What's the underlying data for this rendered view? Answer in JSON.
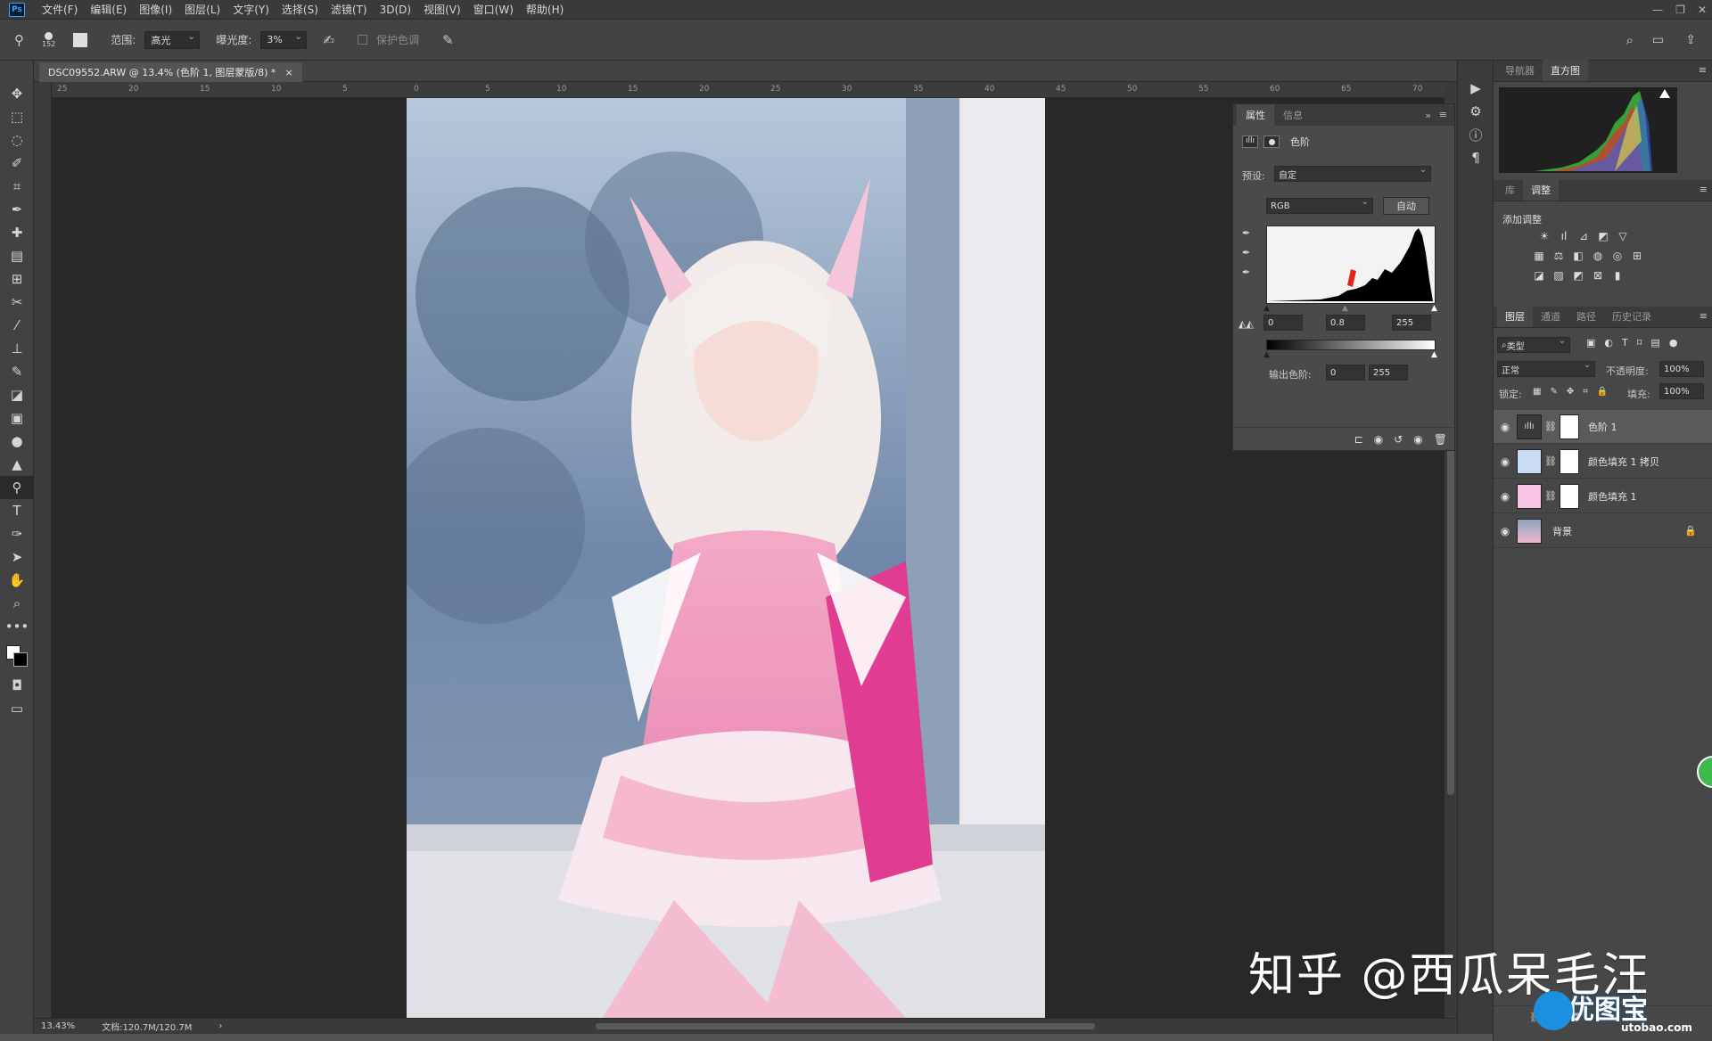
{
  "menubar": {
    "logo": "Ps",
    "items": [
      "文件(F)",
      "编辑(E)",
      "图像(I)",
      "图层(L)",
      "文字(Y)",
      "选择(S)",
      "滤镜(T)",
      "3D(D)",
      "视图(V)",
      "窗口(W)",
      "帮助(H)"
    ]
  },
  "options": {
    "brush_size": "152",
    "range_label": "范围:",
    "range_value": "高光",
    "exposure_label": "曝光度:",
    "exposure_value": "3%",
    "protect_tones": "保护色调"
  },
  "document": {
    "tab_title": "DSC09552.ARW @ 13.4% (色阶 1, 图层蒙版/8) *",
    "close": "×"
  },
  "ruler_h": [
    "25",
    "20",
    "15",
    "10",
    "5",
    "0",
    "5",
    "10",
    "15",
    "20",
    "25",
    "30",
    "35",
    "40",
    "45",
    "50",
    "55",
    "60",
    "65",
    "70"
  ],
  "status": {
    "zoom": "13.43%",
    "doc": "文档:120.7M/120.7M"
  },
  "properties": {
    "tabs": [
      "属性",
      "信息"
    ],
    "title": "色阶",
    "preset_label": "预设:",
    "preset_value": "自定",
    "channel": "RGB",
    "auto": "自动",
    "input_black": "0",
    "input_mid": "0.8",
    "input_white": "255",
    "output_label": "输出色阶:",
    "output_black": "0",
    "output_white": "255"
  },
  "right_top": {
    "tabs": [
      "导航器",
      "直方图"
    ]
  },
  "adjust": {
    "tabs": [
      "库",
      "调整"
    ],
    "title": "添加调整"
  },
  "layers_panel": {
    "tabs": [
      "图层",
      "通道",
      "路径",
      "历史记录"
    ],
    "filter": "类型",
    "blend": "正常",
    "opacity_label": "不透明度:",
    "opacity": "100%",
    "lock_label": "锁定:",
    "fill_label": "填充:",
    "fill": "100%",
    "layers": [
      {
        "name": "色阶 1"
      },
      {
        "name": "颜色填充 1 拷贝"
      },
      {
        "name": "颜色填充 1"
      },
      {
        "name": "背景"
      }
    ]
  },
  "watermark": {
    "text": "知乎 @西瓜呆毛汪",
    "logo": "优图宝",
    "logo_sub": "utobao.com"
  },
  "colors": {
    "accent": "#31a8ff",
    "panel": "#474747",
    "canvas": "#282828"
  }
}
